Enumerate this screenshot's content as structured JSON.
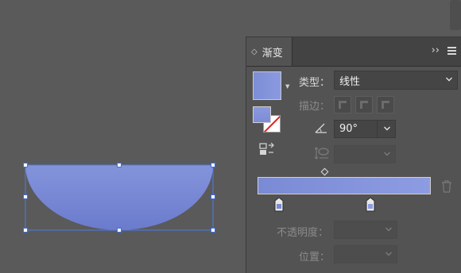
{
  "panel": {
    "tab_title": "渐变",
    "tab_updown_glyph": "◇",
    "expand_glyph": "››",
    "type_label": "类型：",
    "type_value": "线性",
    "stroke_label": "描边：",
    "angle_value": "90°",
    "opacity_label": "不透明度：",
    "position_label": "位置：",
    "gradient_colors": [
      "#7a8ad4",
      "#8d9ce2"
    ]
  },
  "colors": {
    "background": "#5a5a5a",
    "panel_bg": "#535353",
    "shape_fill_top": "#8292d8",
    "shape_fill_bottom": "#6d7ecf",
    "selection": "#3f6fe0"
  }
}
